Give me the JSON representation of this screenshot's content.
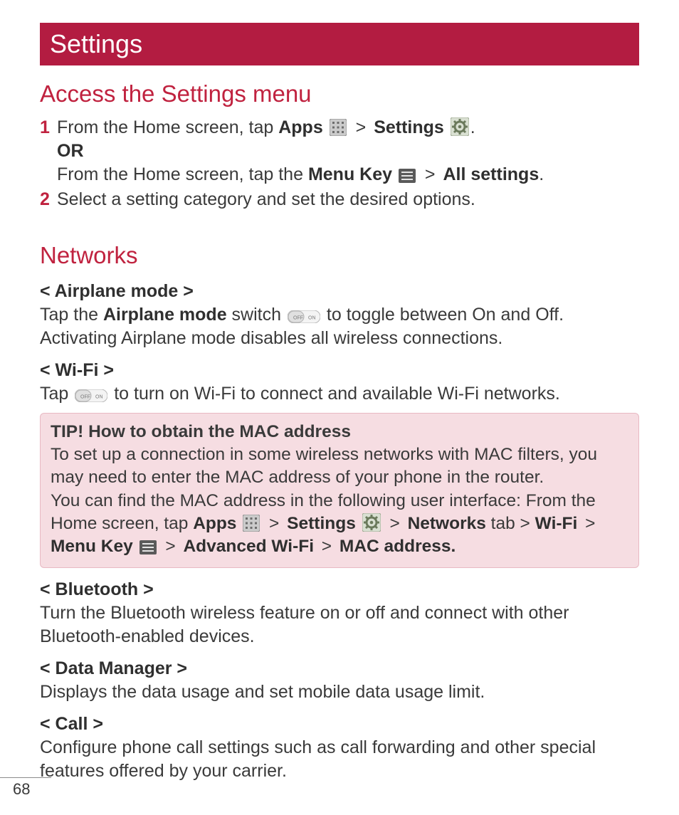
{
  "header": {
    "title": "Settings"
  },
  "section1": {
    "heading": "Access the Settings menu",
    "step1": {
      "num": "1",
      "p1a": "From the Home screen, tap ",
      "apps": "Apps",
      "gt1": " > ",
      "settings": "Settings",
      "dot": ".",
      "or": "OR",
      "p2a": "From the Home screen, tap the ",
      "menukey": "Menu Key",
      "gt2": " > ",
      "allsettings": "All settings",
      "dot2": "."
    },
    "step2": {
      "num": "2",
      "text": "Select a setting category and set the desired options."
    }
  },
  "section2": {
    "heading": "Networks",
    "airplane": {
      "title": "< Airplane mode >",
      "p1a": "Tap the ",
      "bold": "Airplane mode",
      "p1b": " switch ",
      "p1c": " to toggle between On and Off. Activating Airplane mode disables all wireless connections."
    },
    "wifi": {
      "title": "< Wi-Fi >",
      "p1a": "Tap ",
      "p1b": " to turn on Wi-Fi to connect and available Wi-Fi networks."
    },
    "tip": {
      "title": "TIP! How to obtain the MAC address",
      "line1": "To set up a connection in some wireless networks with MAC filters, you may need to enter the MAC address of your phone in the router.",
      "line2a": "You can find the MAC address in the following user interface: From the Home screen, tap ",
      "apps": "Apps",
      "gt1": " > ",
      "settings": "Settings",
      "gt2": " > ",
      "networks": "Networks",
      "tab": " tab > ",
      "wifi": "Wi-Fi",
      "gt3": " > ",
      "menukey": "Menu Key",
      "gt4": " > ",
      "advwifi": "Advanced Wi-Fi",
      "gt5": " > ",
      "mac": "MAC address."
    },
    "bluetooth": {
      "title": "< Bluetooth >",
      "text": "Turn the Bluetooth wireless feature on or off and connect with other Bluetooth-enabled devices."
    },
    "datam": {
      "title": "< Data Manager >",
      "text": "Displays the data usage and set mobile data usage limit."
    },
    "call": {
      "title": "< Call >",
      "text": "Configure phone call settings such as call forwarding and other special features offered by your carrier."
    }
  },
  "page": "68"
}
